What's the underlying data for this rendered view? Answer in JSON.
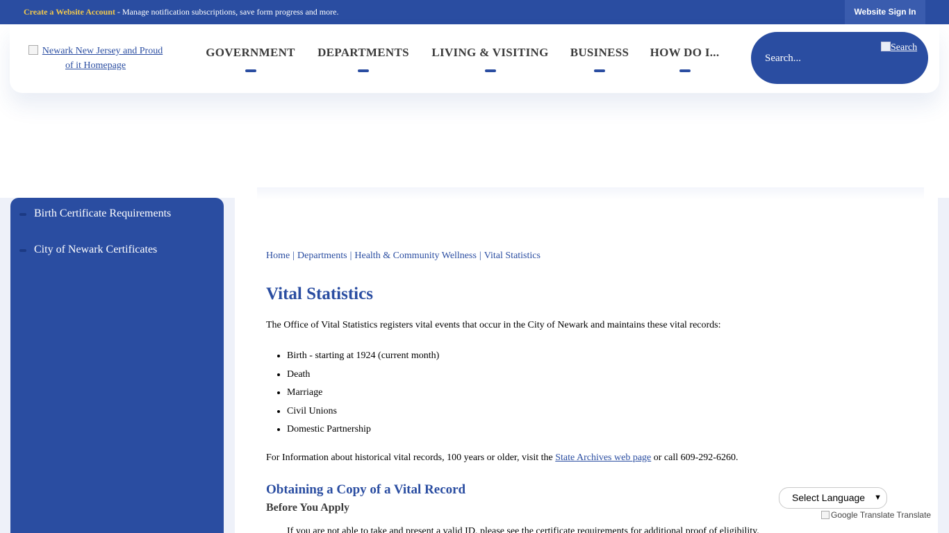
{
  "topbar": {
    "create_account_label": "Create a Website Account",
    "create_account_desc": " - Manage notification subscriptions, save form progress and more.",
    "sign_in_label": "Website Sign In"
  },
  "header": {
    "logo_alt_line1": "Newark New Jersey and Proud",
    "logo_alt_line2": "of it Homepage",
    "nav": [
      {
        "label": "GOVERNMENT"
      },
      {
        "label": "DEPARTMENTS"
      },
      {
        "label": "LIVING & VISITING"
      },
      {
        "label": "BUSINESS"
      },
      {
        "label": "HOW DO I..."
      }
    ],
    "search": {
      "placeholder": "Search...",
      "button_alt": "Search"
    }
  },
  "sidebar": {
    "items": [
      {
        "label": "Birth Certificate Requirements"
      },
      {
        "label": "City of Newark Certificates"
      }
    ]
  },
  "breadcrumb": {
    "home": "Home",
    "departments": "Departments",
    "health": "Health & Community Wellness",
    "current": "Vital Statistics",
    "sep": "|"
  },
  "main": {
    "title": "Vital Statistics",
    "intro": "The Office of Vital Statistics registers vital events that occur in the City of Newark and maintains these vital records:",
    "records": [
      "Birth - starting at 1924 (current month)",
      "Death",
      "Marriage",
      "Civil Unions",
      "Domestic Partnership"
    ],
    "history_pre": "For Information about historical vital records, 100 years or older, visit the ",
    "history_link": "State Archives web page",
    "history_post": " or call 609-292-6260.",
    "subtitle": "Obtaining a Copy of a Vital Record",
    "subsub": "Before You Apply",
    "cutoff_text": "If you are not able to take and present a valid ID, please see the certificate requirements for additional proof of eligibility."
  },
  "translate": {
    "select_label": "Select Language",
    "powered_alt": "Google Translate",
    "powered_label": "Translate"
  }
}
